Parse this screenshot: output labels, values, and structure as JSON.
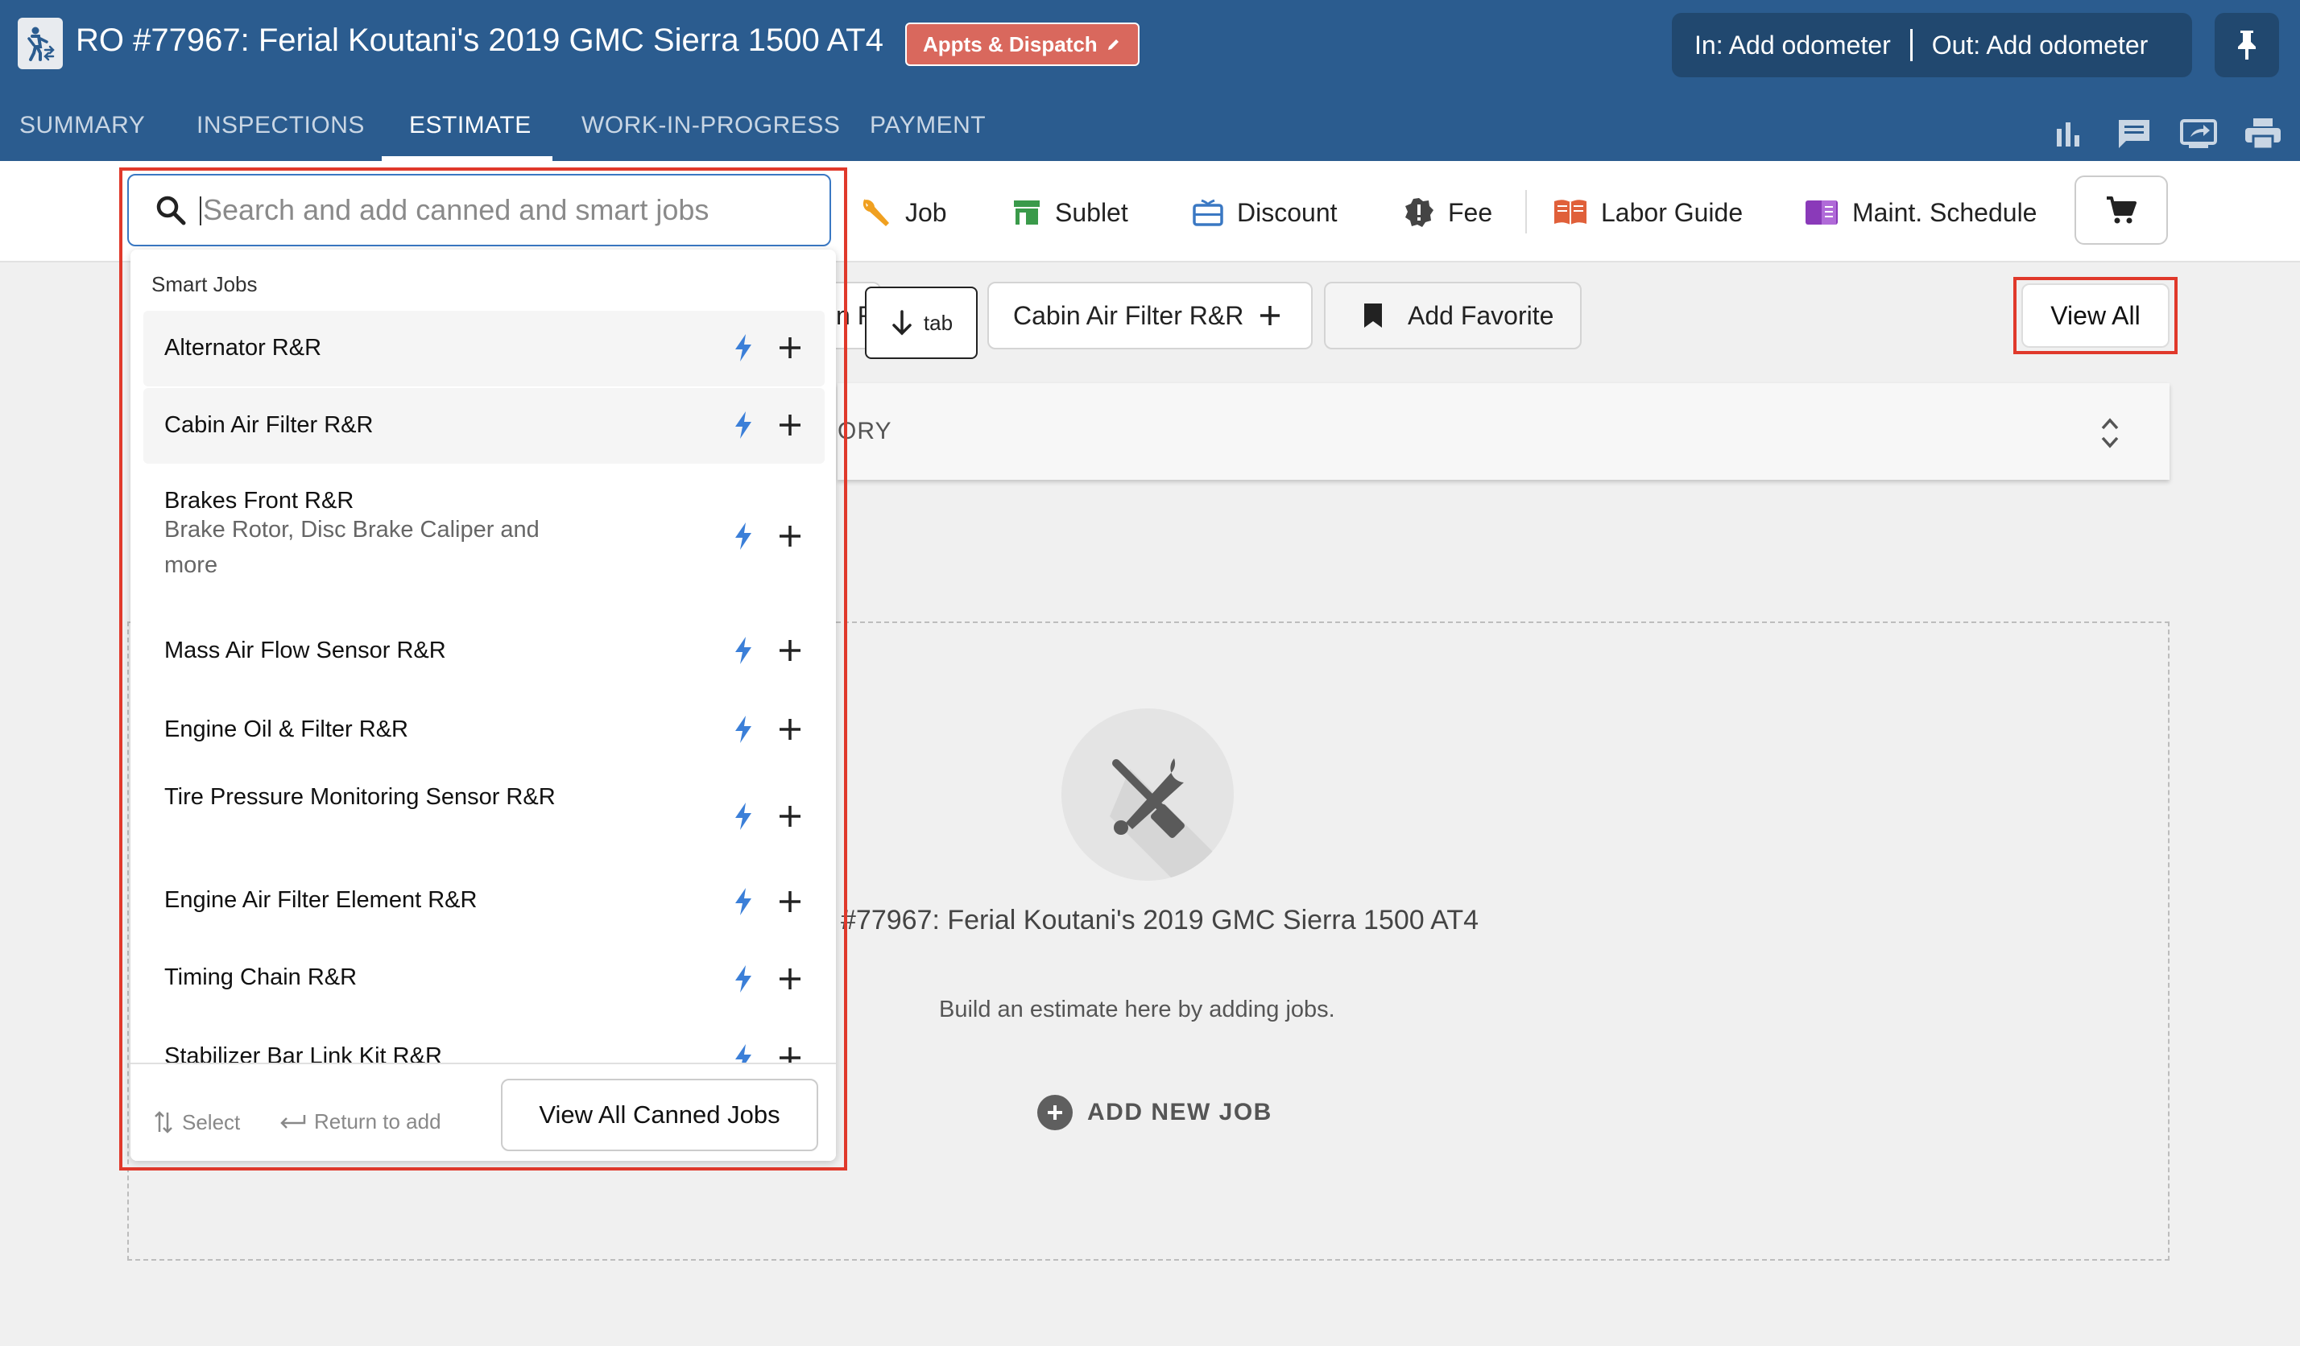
{
  "header": {
    "ro_title": "RO #77967: Ferial Koutani's 2019 GMC Sierra 1500 AT4",
    "appts_badge": "Appts & Dispatch",
    "odometer_in": "In: Add odometer",
    "odometer_out": "Out: Add odometer",
    "bg_color": "#2b5c8f",
    "badge_color": "#d9685d"
  },
  "tabs": [
    {
      "label": "SUMMARY"
    },
    {
      "label": "INSPECTIONS"
    },
    {
      "label": "ESTIMATE",
      "active": true
    },
    {
      "label": "WORK-IN-PROGRESS"
    },
    {
      "label": "PAYMENT"
    }
  ],
  "header_icons": [
    "bar-chart-icon",
    "message-icon",
    "screen-share-icon",
    "print-icon"
  ],
  "toolbar": {
    "search_placeholder": "Search and add canned and smart jobs",
    "search_value": "",
    "job": "Job",
    "sublet": "Sublet",
    "discount": "Discount",
    "fee": "Fee",
    "labor_guide": "Labor Guide",
    "maint_schedule": "Maint. Schedule"
  },
  "favorites": {
    "tab_hint": "tab",
    "chip_partial": "n R",
    "cabin_chip": "Cabin Air Filter R&R",
    "add_favorite": "Add Favorite",
    "view_all": "View All"
  },
  "category_bar": {
    "label": "ORY"
  },
  "empty_state": {
    "title": "#77967: Ferial Koutani's 2019 GMC Sierra 1500 AT4",
    "subtitle": "Build an estimate here by adding jobs.",
    "add_new_job": "ADD NEW JOB"
  },
  "dropdown": {
    "section_header": "Smart Jobs",
    "jobs": [
      {
        "name": "Alternator R&R",
        "desc": ""
      },
      {
        "name": "Cabin Air Filter R&R",
        "desc": ""
      },
      {
        "name": "Brakes Front R&R",
        "desc": "Brake Rotor, Disc Brake Caliper and more"
      },
      {
        "name": "Mass Air Flow Sensor R&R",
        "desc": ""
      },
      {
        "name": "Engine Oil & Filter R&R",
        "desc": ""
      },
      {
        "name": "Tire Pressure Monitoring Sensor R&R",
        "desc": ""
      },
      {
        "name": "Engine Air Filter Element R&R",
        "desc": ""
      },
      {
        "name": "Timing Chain R&R",
        "desc": ""
      },
      {
        "name": "Stabilizer Bar Link Kit R&R",
        "desc": ""
      }
    ],
    "footer": {
      "select_hint": "Select",
      "return_hint": "Return to add",
      "view_all_canned": "View All Canned Jobs"
    }
  },
  "colors": {
    "accent_blue": "#3a78c3",
    "highlight_red": "#e0392b",
    "bolt_blue": "#3b7fd8"
  }
}
